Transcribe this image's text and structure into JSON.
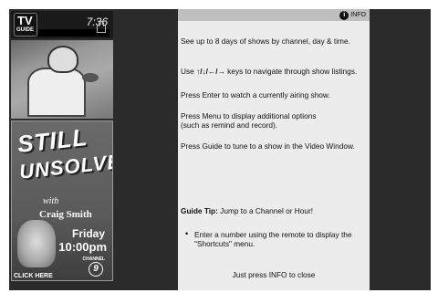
{
  "sidebar": {
    "logo_tv": "TV",
    "logo_guide": "GUIDE",
    "clock": "7:36",
    "promo": {
      "title_line1": "STILL",
      "title_line2": "UNSOLVED",
      "with": "with",
      "host": "Craig Smith",
      "day": "Friday",
      "time": "10:00pm",
      "channel_label": "CHANNEL",
      "channel_number": "9",
      "cta": "CLICK HERE"
    }
  },
  "info": {
    "button_number": "i",
    "button_label": "INFO",
    "line1": "See up to 8 days of shows by channel, day & time.",
    "line2_prefix": "Use ",
    "line2_arrows": "↑/↓/←/→",
    "line2_suffix": " keys to navigate through show listings.",
    "line3": "Press Enter to watch a currently airing show.",
    "line4a": "Press Menu to display additional options",
    "line4b": "(such as remind and record).",
    "line5": "Press Guide to tune to a show in the Video Window.",
    "tip_label": "Guide Tip:",
    "tip_text": " Jump to a Channel or Hour!",
    "bullet_a": "Enter a number using the remote to display the",
    "bullet_b": "\"Shortcuts\" menu.",
    "close": "Just press INFO to close"
  }
}
